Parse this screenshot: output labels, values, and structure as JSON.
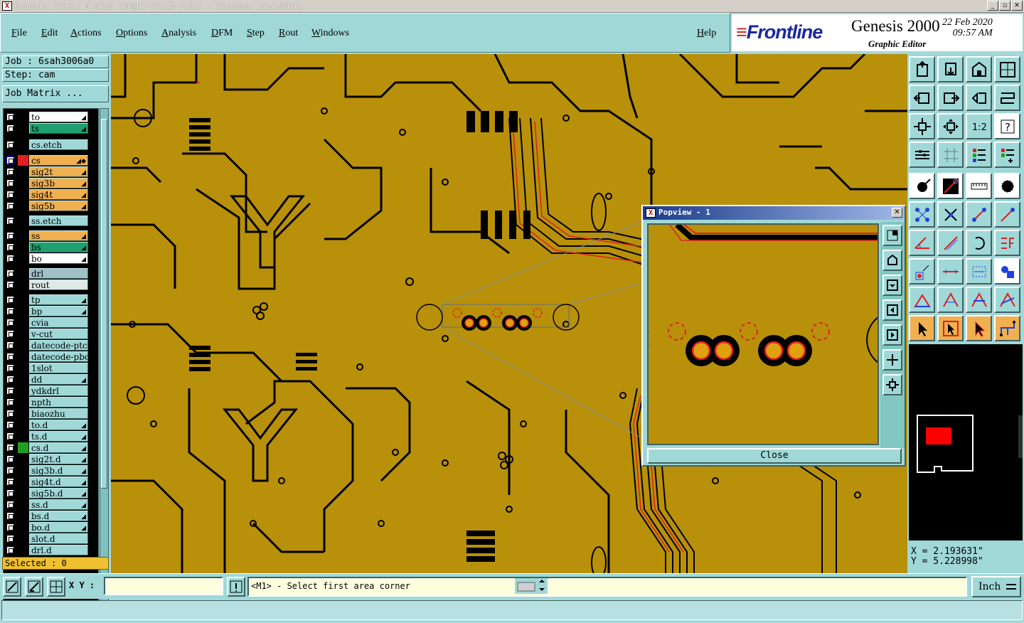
{
  "window": {
    "title": "Graphic Editor 9.07b2 (OO@HY-HYCAM-PC017 - Windows, pid:9064)"
  },
  "menu": [
    "File",
    "Edit",
    "Actions",
    "Options",
    "Analysis",
    "DFM",
    "Step",
    "Rout",
    "Windows"
  ],
  "help_label": "Help",
  "brand": {
    "logo": "Frontline",
    "product": "Genesis 2000",
    "subtitle": "Graphic Editor",
    "date": "22 Feb 2020",
    "time": "09:57 AM"
  },
  "job": {
    "job_line": "Job : 6sah3006a0",
    "step_line": "Step: cam",
    "matrix_button": "Job Matrix ..."
  },
  "layers": [
    {
      "name": "to",
      "color": "#ffffff",
      "sw": "#000000",
      "flag": "◢"
    },
    {
      "name": "ts",
      "color": "#20a070",
      "sw": "#000000",
      "flag": "◢"
    },
    {
      "name": "cs.etch",
      "color": "#a0d8d8",
      "sw": "#000000",
      "flag": ""
    },
    {
      "name": "cs",
      "color": "#f0b050",
      "sw": "#e02020",
      "flag": "◢◆"
    },
    {
      "name": "sig2t",
      "color": "#f0b050",
      "sw": "#000000",
      "flag": "◢"
    },
    {
      "name": "sig3b",
      "color": "#f0b050",
      "sw": "#000000",
      "flag": "◢"
    },
    {
      "name": "sig4t",
      "color": "#f0b050",
      "sw": "#000000",
      "flag": "◢"
    },
    {
      "name": "sig5b",
      "color": "#f0b050",
      "sw": "#000000",
      "flag": "◢"
    },
    {
      "name": "ss.etch",
      "color": "#a0d8d8",
      "sw": "#000000",
      "flag": ""
    },
    {
      "name": "ss",
      "color": "#f0b050",
      "sw": "#000000",
      "flag": "◢"
    },
    {
      "name": "bs",
      "color": "#20a070",
      "sw": "#000000",
      "flag": "◢"
    },
    {
      "name": "bo",
      "color": "#ffffff",
      "sw": "#000000",
      "flag": "◢"
    },
    {
      "name": "drl",
      "color": "#a0c0c8",
      "sw": "#000000",
      "flag": ""
    },
    {
      "name": "rout",
      "color": "#e0e8e8",
      "sw": "#000000",
      "flag": ""
    },
    {
      "name": "tp",
      "color": "#a0d8d8",
      "sw": "#000000",
      "flag": "◢"
    },
    {
      "name": "bp",
      "color": "#a0d8d8",
      "sw": "#000000",
      "flag": "◢"
    },
    {
      "name": "cvia",
      "color": "#a0d8d8",
      "sw": "#000000",
      "flag": ""
    },
    {
      "name": "v-cut",
      "color": "#a0d8d8",
      "sw": "#000000",
      "flag": ""
    },
    {
      "name": "datecode-ptc",
      "color": "#a0d8d8",
      "sw": "#000000",
      "flag": ""
    },
    {
      "name": "datecode-pbc",
      "color": "#a0d8d8",
      "sw": "#000000",
      "flag": ""
    },
    {
      "name": "1slot",
      "color": "#a0d8d8",
      "sw": "#000000",
      "flag": ""
    },
    {
      "name": "dd",
      "color": "#a0d8d8",
      "sw": "#000000",
      "flag": "◢"
    },
    {
      "name": "ydkdrl",
      "color": "#a0d8d8",
      "sw": "#000000",
      "flag": ""
    },
    {
      "name": "npth",
      "color": "#a0d8d8",
      "sw": "#000000",
      "flag": ""
    },
    {
      "name": "biaozhu",
      "color": "#a0d8d8",
      "sw": "#000000",
      "flag": ""
    },
    {
      "name": "to.d",
      "color": "#a0d8d8",
      "sw": "#000000",
      "flag": "◢"
    },
    {
      "name": "ts.d",
      "color": "#a0d8d8",
      "sw": "#000000",
      "flag": "◢"
    },
    {
      "name": "cs.d",
      "color": "#a0d8d8",
      "sw": "#20a020",
      "flag": "◢"
    },
    {
      "name": "sig2t.d",
      "color": "#a0d8d8",
      "sw": "#000000",
      "flag": "◢"
    },
    {
      "name": "sig3b.d",
      "color": "#a0d8d8",
      "sw": "#000000",
      "flag": "◢"
    },
    {
      "name": "sig4t.d",
      "color": "#a0d8d8",
      "sw": "#000000",
      "flag": "◢"
    },
    {
      "name": "sig5b.d",
      "color": "#a0d8d8",
      "sw": "#000000",
      "flag": "◢"
    },
    {
      "name": "ss.d",
      "color": "#a0d8d8",
      "sw": "#000000",
      "flag": "◢"
    },
    {
      "name": "bs.d",
      "color": "#a0d8d8",
      "sw": "#000000",
      "flag": "◢"
    },
    {
      "name": "bo.d",
      "color": "#a0d8d8",
      "sw": "#000000",
      "flag": "◢"
    },
    {
      "name": "slot.d",
      "color": "#a0d8d8",
      "sw": "#000000",
      "flag": ""
    },
    {
      "name": "drl.d",
      "color": "#a0d8d8",
      "sw": "#000000",
      "flag": ""
    }
  ],
  "selected": "Selected : 0",
  "popview": {
    "title": "Popview - 1",
    "close_label": "Close"
  },
  "coords": {
    "x": "X = 2.193631\"",
    "y": "Y = 5.228998\""
  },
  "bottom": {
    "xy_label": "X Y :",
    "xy_value": "",
    "message": "<M1> - Select first area corner",
    "unit": "Inch"
  },
  "tools": [
    "home-icon",
    "next-icon",
    "house-icon",
    "window-icon",
    "left-icon",
    "right-icon",
    "step-icon",
    "snap-icon",
    "zoom-fit-icon",
    "center-icon",
    "ratio-icon",
    "help-icon",
    "gear-icon",
    "grid-icon",
    "layers-icon",
    "filter-icon",
    "pad-icon",
    "net-icon",
    "ruler-icon",
    "circle-icon",
    "node-icon",
    "cross-icon",
    "pt-icon",
    "arrow-icon",
    "line-icon",
    "edit-icon",
    "arc-icon",
    "flag-icon",
    "move-icon",
    "slide-icon",
    "dim-icon",
    "group-icon",
    "tri-icon",
    "poly-icon",
    "poly2-icon",
    "poly3-icon",
    "cursor-icon",
    "cursor2-icon",
    "cursor3-icon",
    "branch-icon"
  ]
}
